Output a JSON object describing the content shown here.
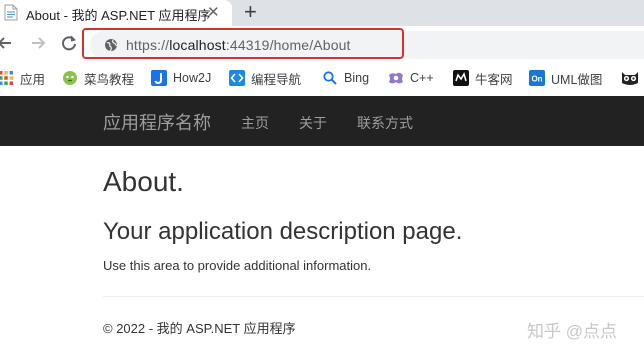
{
  "browser": {
    "tab": {
      "title": "About - 我的 ASP.NET 应用程序",
      "close_glyph": "✕"
    },
    "new_tab_glyph": "+",
    "address": {
      "scheme": "https://",
      "host": "localhost",
      "port_path": ":44319/home/About",
      "highlight_color": "#d9302c"
    }
  },
  "bookmarks": [
    {
      "label": "应用",
      "icon": "apps-grid-icon",
      "color": "#e8453c"
    },
    {
      "label": "菜鸟教程",
      "icon": "runoob-icon",
      "color": "#6aa84f"
    },
    {
      "label": "How2J",
      "icon": "how2j-icon",
      "color": "#1a73e8"
    },
    {
      "label": "编程导航",
      "icon": "code-nav-icon",
      "color": "#1e88e5"
    },
    {
      "label": "Bing",
      "icon": "search-icon",
      "color": "#1a73e8"
    },
    {
      "label": "C++",
      "icon": "cpp-icon",
      "color": "#7e57c2"
    },
    {
      "label": "牛客网",
      "icon": "nowcoder-icon",
      "color": "#111111"
    },
    {
      "label": "UML做图",
      "icon": "uml-icon",
      "color": "#1976d2"
    }
  ],
  "navbar": {
    "brand": "应用程序名称",
    "links": [
      "主页",
      "关于",
      "联系方式"
    ]
  },
  "content": {
    "title": "About.",
    "subtitle": "Your application description page.",
    "body": "Use this area to provide additional information.",
    "footer": "© 2022 - 我的 ASP.NET 应用程序"
  },
  "watermark": "知乎 @点点"
}
